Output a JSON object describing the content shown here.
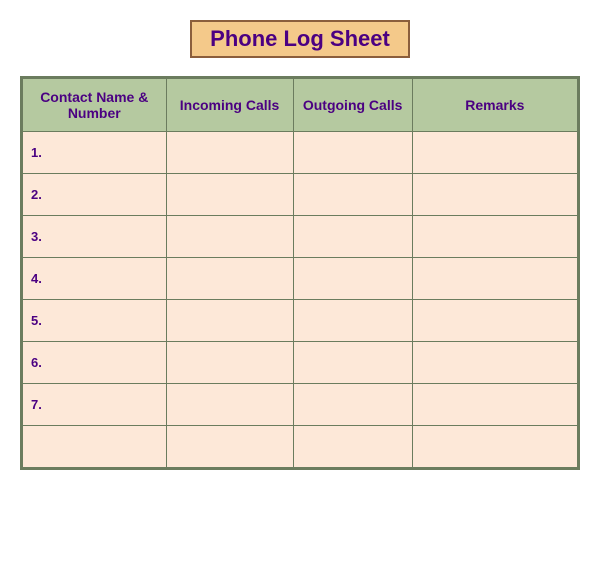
{
  "title": "Phone Log Sheet",
  "columns": [
    {
      "key": "contact",
      "label": "Contact Name &\nNumber"
    },
    {
      "key": "incoming",
      "label": "Incoming Calls"
    },
    {
      "key": "outgoing",
      "label": "Outgoing Calls"
    },
    {
      "key": "remarks",
      "label": "Remarks"
    }
  ],
  "rows": [
    {
      "num": "1.",
      "contact": "",
      "incoming": "",
      "outgoing": "",
      "remarks": ""
    },
    {
      "num": "2.",
      "contact": "",
      "incoming": "",
      "outgoing": "",
      "remarks": ""
    },
    {
      "num": "3.",
      "contact": "",
      "incoming": "",
      "outgoing": "",
      "remarks": ""
    },
    {
      "num": "4.",
      "contact": "",
      "incoming": "",
      "outgoing": "",
      "remarks": ""
    },
    {
      "num": "5.",
      "contact": "",
      "incoming": "",
      "outgoing": "",
      "remarks": ""
    },
    {
      "num": "6.",
      "contact": "",
      "incoming": "",
      "outgoing": "",
      "remarks": ""
    },
    {
      "num": "7.",
      "contact": "",
      "incoming": "",
      "outgoing": "",
      "remarks": ""
    },
    {
      "num": "",
      "contact": "",
      "incoming": "",
      "outgoing": "",
      "remarks": ""
    }
  ]
}
